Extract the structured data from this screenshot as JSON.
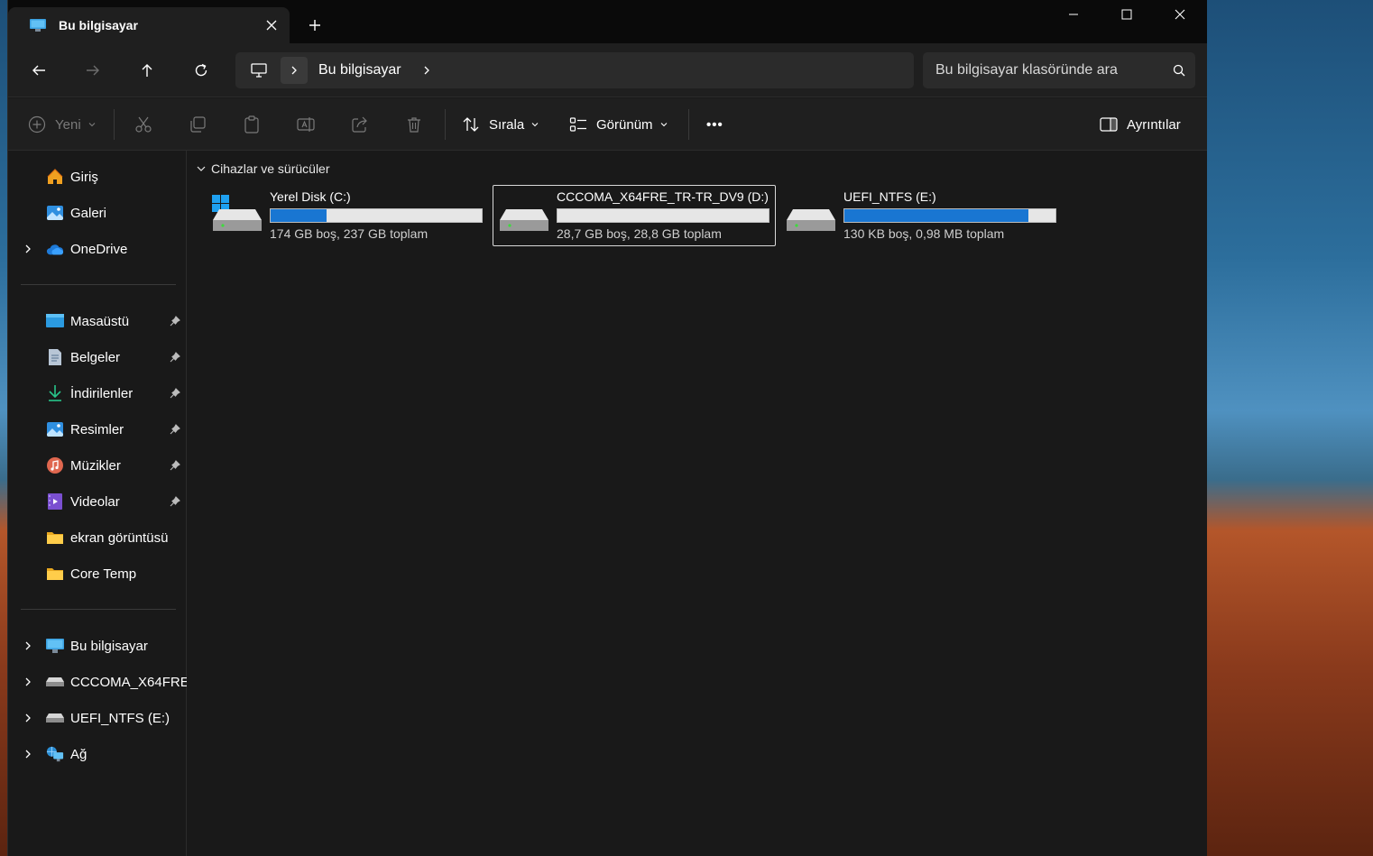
{
  "window": {
    "tab_title": "Bu bilgisayar",
    "tab_icon": "pc-icon"
  },
  "navigation": {
    "address": "Bu bilgisayar",
    "search_placeholder": "Bu bilgisayar klasöründe ara"
  },
  "command_bar": {
    "new_label": "Yeni",
    "sort_label": "Sırala",
    "view_label": "Görünüm",
    "details_label": "Ayrıntılar",
    "more_label": "•••"
  },
  "sidebar": {
    "quick": [
      {
        "label": "Giriş",
        "icon": "home-icon"
      },
      {
        "label": "Galeri",
        "icon": "gallery-icon"
      },
      {
        "label": "OneDrive",
        "icon": "cloud-icon"
      }
    ],
    "pinned": [
      {
        "label": "Masaüstü",
        "icon": "desktop-icon"
      },
      {
        "label": "Belgeler",
        "icon": "documents-icon"
      },
      {
        "label": "İndirilenler",
        "icon": "download-icon"
      },
      {
        "label": "Resimler",
        "icon": "pictures-icon"
      },
      {
        "label": "Müzikler",
        "icon": "music-icon"
      },
      {
        "label": "Videolar",
        "icon": "video-icon"
      },
      {
        "label": "ekran görüntüsü",
        "icon": "folder-icon"
      },
      {
        "label": "Core Temp",
        "icon": "folder-icon"
      }
    ],
    "tree": [
      {
        "label": "Bu bilgisayar",
        "icon": "pc-icon"
      },
      {
        "label": "CCCOMA_X64FRE_TR-TR_DV9 (D:)",
        "icon": "drive-icon"
      },
      {
        "label": "UEFI_NTFS (E:)",
        "icon": "drive-icon"
      },
      {
        "label": "Ağ",
        "icon": "network-icon"
      }
    ]
  },
  "content": {
    "group_header": "Cihazlar ve sürücüler",
    "drives": [
      {
        "name": "Yerel Disk (C:)",
        "size_text": "174 GB boş, 237 GB toplam",
        "used_fraction": 0.266,
        "selected": false
      },
      {
        "name": "CCCOMA_X64FRE_TR-TR_DV9 (D:)",
        "size_text": "28,7 GB boş, 28,8 GB toplam",
        "used_fraction": 0.0,
        "selected": true
      },
      {
        "name": "UEFI_NTFS (E:)",
        "size_text": "130 KB boş, 0,98 MB toplam",
        "used_fraction": 0.87,
        "selected": false
      }
    ]
  },
  "colors": {
    "accent": "#1976d2",
    "window_bg": "#191919",
    "titlebar_bg": "#0a0a0a"
  }
}
